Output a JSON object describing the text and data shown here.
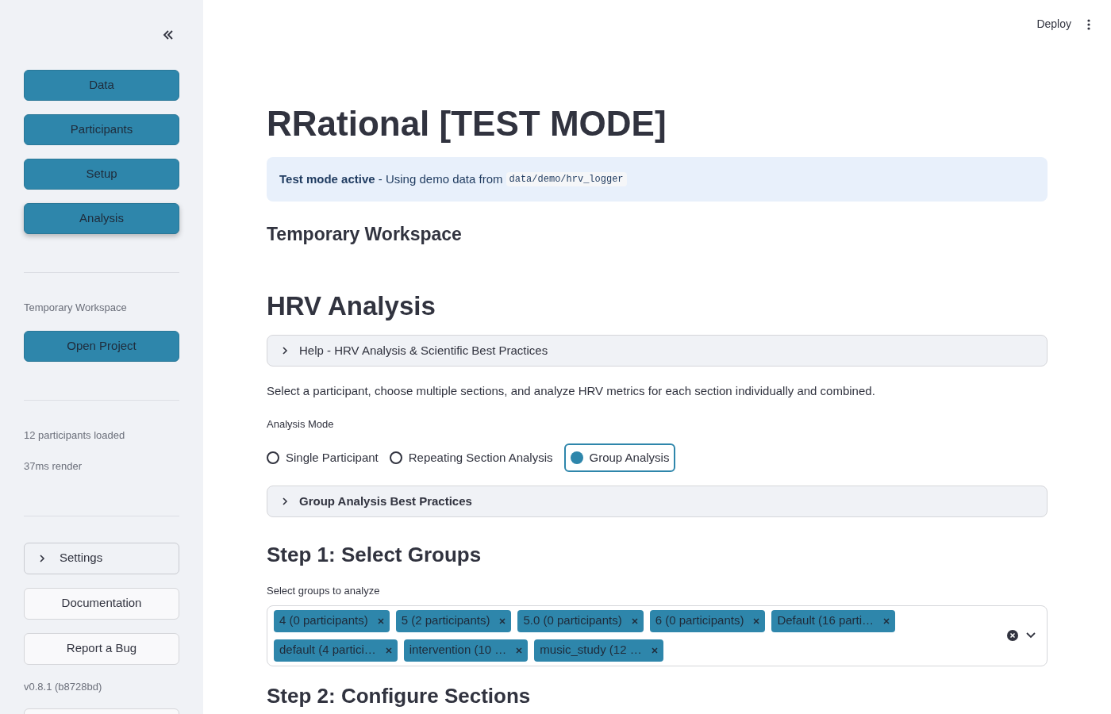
{
  "sidebar": {
    "nav": [
      {
        "label": "Data",
        "selected": false
      },
      {
        "label": "Participants",
        "selected": false
      },
      {
        "label": "Setup",
        "selected": false
      },
      {
        "label": "Analysis",
        "selected": true
      }
    ],
    "workspace_label": "Temporary Workspace",
    "open_project": "Open Project",
    "stats": [
      "12 participants loaded",
      "37ms render"
    ],
    "settings": {
      "label": "Settings",
      "expanded": false
    },
    "links": [
      "Documentation",
      "Report a Bug"
    ],
    "version": "v0.8.1 (b8728bd)"
  },
  "header": {
    "deploy": "Deploy"
  },
  "title": "RRational [TEST MODE]",
  "info": {
    "text": "**Test mode active** - Using demo data from",
    "code": "data/demo/hrv_logger"
  },
  "workspace_heading": "Temporary Workspace",
  "section_heading": "HRV Analysis",
  "help_expander": {
    "label": "Help - HRV Analysis & Scientific Best Practices",
    "expanded": false
  },
  "description": "Select a participant, choose multiple sections, and analyze HRV metrics for each section individually and combined.",
  "analysis_mode": {
    "label": "Analysis Mode",
    "options": [
      {
        "label": "Single Participant",
        "selected": false
      },
      {
        "label": "Repeating Section Analysis",
        "selected": false
      },
      {
        "label": "Group Analysis",
        "selected": true
      }
    ]
  },
  "best_practices": {
    "label": "Group Analysis Best Practices",
    "expanded": false
  },
  "step1": "Step 1: Select Groups",
  "groups": {
    "label": "Select groups to analyze",
    "tags": [
      "4 (0 participants)",
      "5 (2 participants)",
      "5.0 (0 participants)",
      "6 (0 participants)",
      "Default (16 parti…",
      "default (4 partici…",
      "intervention (10 …",
      "music_study (12 …"
    ]
  },
  "step2": "Step 2: Configure Sections"
}
